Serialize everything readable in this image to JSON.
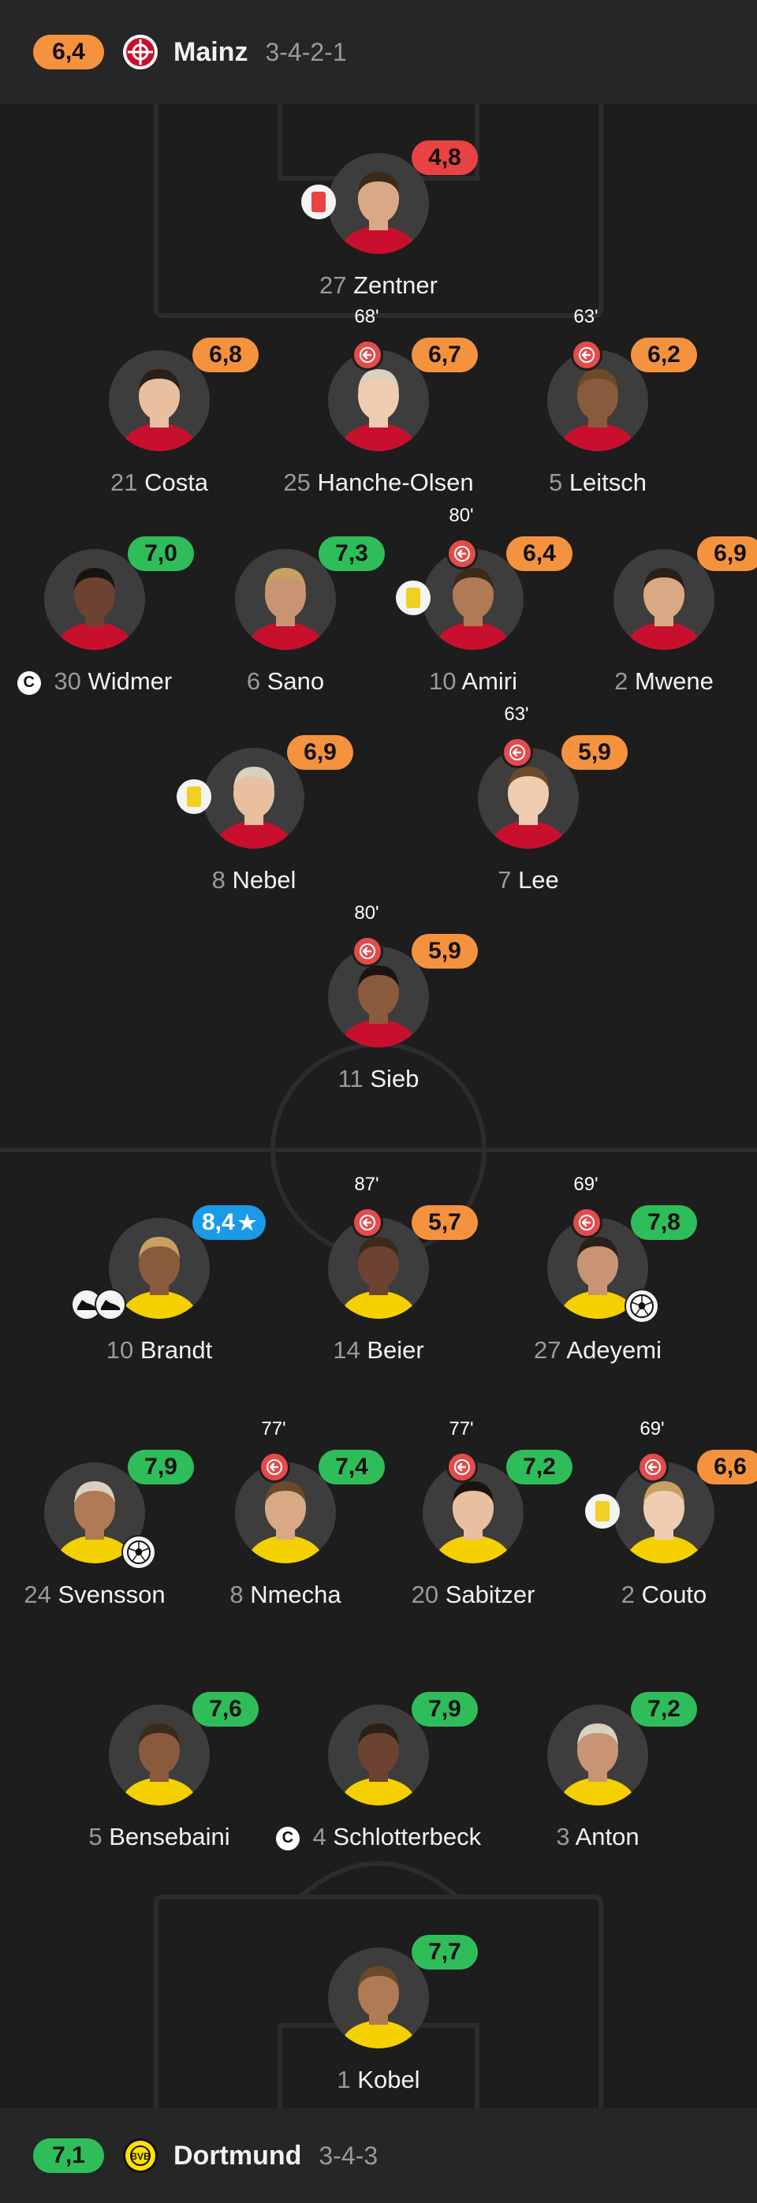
{
  "colors": {
    "green": "#2fbd5a",
    "orange": "#f5923e",
    "red": "#e94242",
    "blue": "#1b9ae8",
    "yellow": "#f0d020",
    "red_card": "#e94242"
  },
  "home": {
    "rating": "6,4",
    "rating_color": "orange",
    "name": "Mainz",
    "formation": "3-4-2-1",
    "logo_icon": "mainz-crest-icon",
    "players": [
      {
        "id": "zentner",
        "number": "27",
        "name": "Zentner",
        "rating": "4,8",
        "color": "red",
        "card": "red"
      },
      {
        "id": "costa",
        "number": "21",
        "name": "Costa",
        "rating": "6,8",
        "color": "orange"
      },
      {
        "id": "hanche-olsen",
        "number": "25",
        "name": "Hanche-Olsen",
        "rating": "6,7",
        "color": "orange",
        "sub": "68'"
      },
      {
        "id": "leitsch",
        "number": "5",
        "name": "Leitsch",
        "rating": "6,2",
        "color": "orange",
        "sub": "63'"
      },
      {
        "id": "widmer",
        "number": "30",
        "name": "Widmer",
        "rating": "7,0",
        "color": "green",
        "captain": "C"
      },
      {
        "id": "sano",
        "number": "6",
        "name": "Sano",
        "rating": "7,3",
        "color": "green"
      },
      {
        "id": "amiri",
        "number": "10",
        "name": "Amiri",
        "rating": "6,4",
        "color": "orange",
        "sub": "80'",
        "card": "yellow"
      },
      {
        "id": "mwene",
        "number": "2",
        "name": "Mwene",
        "rating": "6,9",
        "color": "orange"
      },
      {
        "id": "nebel",
        "number": "8",
        "name": "Nebel",
        "rating": "6,9",
        "color": "orange",
        "card": "yellow"
      },
      {
        "id": "lee",
        "number": "7",
        "name": "Lee",
        "rating": "5,9",
        "color": "orange",
        "sub": "63'"
      },
      {
        "id": "sieb",
        "number": "11",
        "name": "Sieb",
        "rating": "5,9",
        "color": "orange",
        "sub": "80'"
      }
    ]
  },
  "away": {
    "rating": "7,1",
    "rating_color": "green",
    "name": "Dortmund",
    "formation": "3-4-3",
    "logo_icon": "bvb-crest-icon",
    "players": [
      {
        "id": "brandt",
        "number": "10",
        "name": "Brandt",
        "rating": "8,4",
        "color": "blue",
        "star": "★",
        "boots": true
      },
      {
        "id": "beier",
        "number": "14",
        "name": "Beier",
        "rating": "5,7",
        "color": "orange",
        "sub": "87'"
      },
      {
        "id": "adeyemi",
        "number": "27",
        "name": "Adeyemi",
        "rating": "7,8",
        "color": "green",
        "sub": "69'",
        "goal": true
      },
      {
        "id": "svensson",
        "number": "24",
        "name": "Svensson",
        "rating": "7,9",
        "color": "green",
        "goal": true
      },
      {
        "id": "nmecha",
        "number": "8",
        "name": "Nmecha",
        "rating": "7,4",
        "color": "green",
        "sub": "77'"
      },
      {
        "id": "sabitzer",
        "number": "20",
        "name": "Sabitzer",
        "rating": "7,2",
        "color": "green",
        "sub": "77'"
      },
      {
        "id": "couto",
        "number": "2",
        "name": "Couto",
        "rating": "6,6",
        "color": "orange",
        "sub": "69'",
        "card": "yellow"
      },
      {
        "id": "bensebaini",
        "number": "5",
        "name": "Bensebaini",
        "rating": "7,6",
        "color": "green"
      },
      {
        "id": "schlotterbeck",
        "number": "4",
        "name": "Schlotterbeck",
        "rating": "7,9",
        "color": "green",
        "captain": "C"
      },
      {
        "id": "anton",
        "number": "3",
        "name": "Anton",
        "rating": "7,2",
        "color": "green"
      },
      {
        "id": "kobel",
        "number": "1",
        "name": "Kobel",
        "rating": "7,7",
        "color": "green"
      }
    ]
  }
}
